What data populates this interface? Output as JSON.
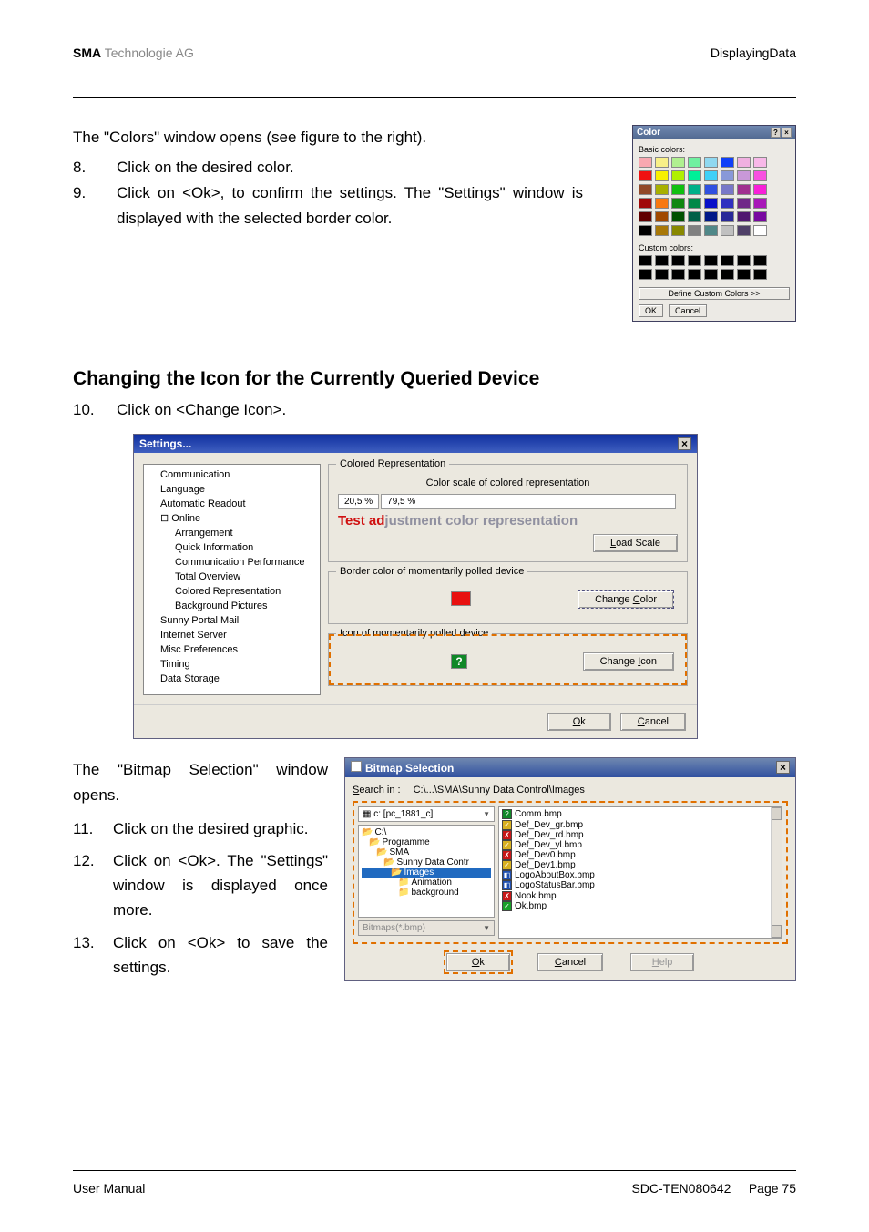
{
  "header": {
    "company_bold": "SMA",
    "company_light": " Technologie AG",
    "right": "DisplayingData"
  },
  "intro": "The \"Colors\" window opens (see figure to the right).",
  "steps_a": [
    {
      "n": "8.",
      "t": "Click on the desired color."
    },
    {
      "n": "9.",
      "t": "Click on <Ok>, to confirm the settings. The \"Settings\" window is displayed with the selected border color."
    }
  ],
  "color_dialog": {
    "title": "Color",
    "basic_label": "Basic colors:",
    "custom_label": "Custom colors:",
    "define": "Define Custom Colors >>",
    "ok": "OK",
    "cancel": "Cancel",
    "basic_colors": [
      "#f8a8b0",
      "#f8f088",
      "#b0f090",
      "#70f0a0",
      "#90d8f0",
      "#1040f8",
      "#f0b0e0",
      "#f8b8e8",
      "#f01010",
      "#f8f000",
      "#b0f000",
      "#00f098",
      "#40d0f8",
      "#8898d8",
      "#c898d8",
      "#f850e0",
      "#904828",
      "#a8b000",
      "#10c010",
      "#00b088",
      "#3050e0",
      "#7878c8",
      "#a03090",
      "#f820d8",
      "#a00808",
      "#f87810",
      "#108810",
      "#008848",
      "#0810c8",
      "#3030c0",
      "#702888",
      "#a818b8",
      "#600000",
      "#a04800",
      "#005000",
      "#006048",
      "#001888",
      "#282898",
      "#501870",
      "#7808a0",
      "#000000",
      "#a87808",
      "#888800",
      "#808080",
      "#508888",
      "#c0c0c0",
      "#504068",
      "#ffffff"
    ]
  },
  "section_heading": "Changing the Icon for the Currently Queried Device",
  "step10": {
    "n": "10.",
    "t": "Click on <Change Icon>."
  },
  "settings_fig": {
    "title": "Settings...",
    "tree": [
      "Communication",
      "Language",
      "Automatic Readout",
      "Online",
      "Arrangement",
      "Quick Information",
      "Communication Performance",
      "Total Overview",
      "Colored Representation",
      "Background Pictures",
      "Sunny Portal Mail",
      "Internet Server",
      "Misc Preferences",
      "Timing",
      "Data Storage"
    ],
    "grp1": {
      "label": "Colored Representation",
      "sub": "Color scale of colored representation",
      "pct1": "20,5 %",
      "pct2": "79,5 %",
      "test": {
        "red": "Test ad",
        "grey": "justment color representation"
      },
      "btn": "Load Scale"
    },
    "grp2": {
      "label": "Border color of momentarily polled device",
      "btn_text": "Change ",
      "btn_u": "C",
      "btn_after": "olor"
    },
    "grp3": {
      "label": "Icon of momentarily polled device",
      "icon": "?",
      "btn_text": "Change ",
      "btn_u": "I",
      "btn_after": "con"
    },
    "ok": "Ok",
    "ok_u": "O",
    "cancel": "Cancel",
    "cancel_u": "C"
  },
  "bitmap_intro": "The \"Bitmap Selection\" window opens.",
  "steps_b": [
    {
      "n": "11.",
      "t": "Click on the desired graphic."
    },
    {
      "n": "12.",
      "t": "Click on <Ok>. The \"Settings\" window is displayed once more."
    },
    {
      "n": "13.",
      "t": "Click on <Ok> to save the settings."
    }
  ],
  "bmp_dialog": {
    "title": "Bitmap Selection",
    "search_u": "S",
    "search_label_after": "earch in :",
    "path": "C:\\...\\SMA\\Sunny Data Control\\Images",
    "drive": "c: [pc_1881_c]",
    "dirs": [
      "C:\\",
      "Programme",
      "SMA",
      "Sunny Data Contr",
      "Images",
      "Animation",
      "background"
    ],
    "filter": "Bitmaps(*.bmp)",
    "files": [
      "Comm.bmp",
      "Def_Dev_gr.bmp",
      "Def_Dev_rd.bmp",
      "Def_Dev_yl.bmp",
      "Def_Dev0.bmp",
      "Def_Dev1.bmp",
      "LogoAboutBox.bmp",
      "LogoStatusBar.bmp",
      "Nook.bmp",
      "Ok.bmp"
    ],
    "file_icons": [
      "?",
      "✓",
      "✗",
      "✓",
      "✗",
      "✓",
      "◧",
      "◧",
      "✗",
      "✓"
    ],
    "file_icon_colors": [
      "#108828",
      "#d8b020",
      "#c81818",
      "#d8b020",
      "#c81818",
      "#d8b020",
      "#2050b0",
      "#2050b0",
      "#c81818",
      "#18a028"
    ],
    "ok": "Ok",
    "ok_u": "O",
    "cancel": "Cancel",
    "cancel_u": "C",
    "help": "Help",
    "help_u": "H"
  },
  "footer": {
    "left": "User Manual",
    "doc": "SDC-TEN080642",
    "page_label": "Page ",
    "page_num": "75"
  }
}
